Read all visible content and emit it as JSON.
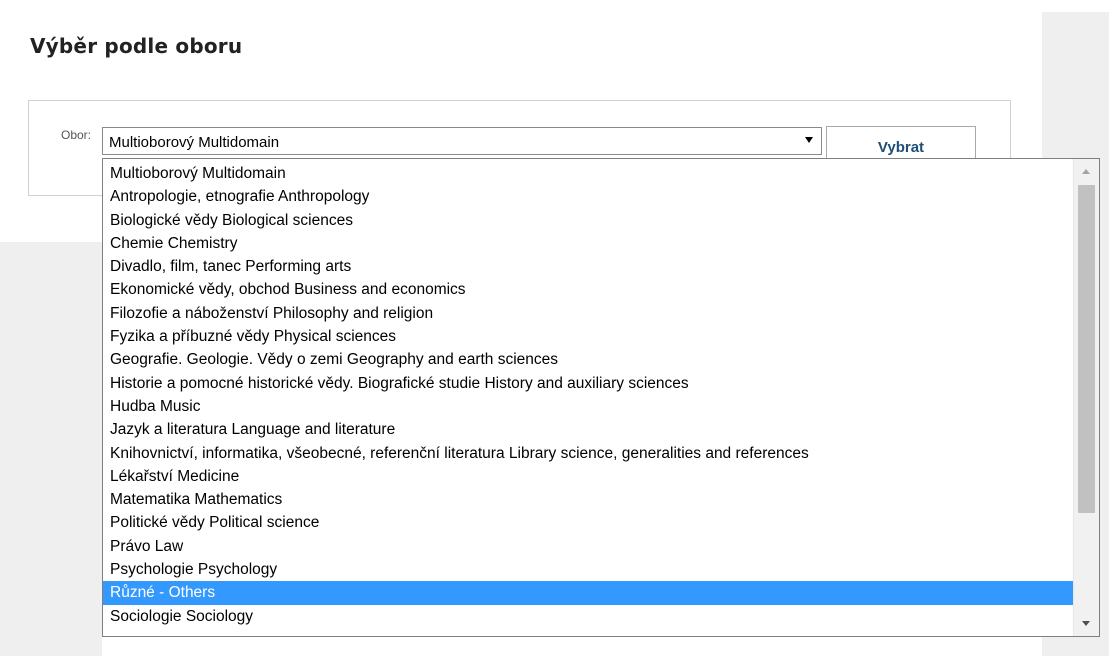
{
  "heading": "Výběr podle oboru",
  "form": {
    "field_label": "Obor:",
    "selected_value": "Multioborový Multidomain",
    "submit_label": "Vybrat"
  },
  "dropdown": {
    "highlighted_option": "Různé - Others",
    "options": [
      "Multioborový Multidomain",
      "Antropologie, etnografie Anthropology",
      "Biologické vědy Biological sciences",
      "Chemie Chemistry",
      "Divadlo, film, tanec Performing arts",
      "Ekonomické vědy, obchod Business and economics",
      "Filozofie a náboženství Philosophy and religion",
      "Fyzika a příbuzné vědy Physical sciences",
      "Geografie. Geologie. Vědy o zemi Geography and earth sciences",
      "Historie a pomocné historické vědy. Biografické studie History and auxiliary sciences",
      "Hudba Music",
      "Jazyk a literatura Language and literature",
      "Knihovnictví, informatika, všeobecné, referenční literatura Library science, generalities and references",
      "Lékařství Medicine",
      "Matematika Mathematics",
      "Politické vědy Political science",
      "Právo Law",
      "Psychologie Psychology",
      "Různé - Others",
      "Sociologie Sociology"
    ]
  },
  "colors": {
    "highlight": "#3399ff",
    "button_text": "#1f4e79",
    "panel_background": "#efefef"
  }
}
